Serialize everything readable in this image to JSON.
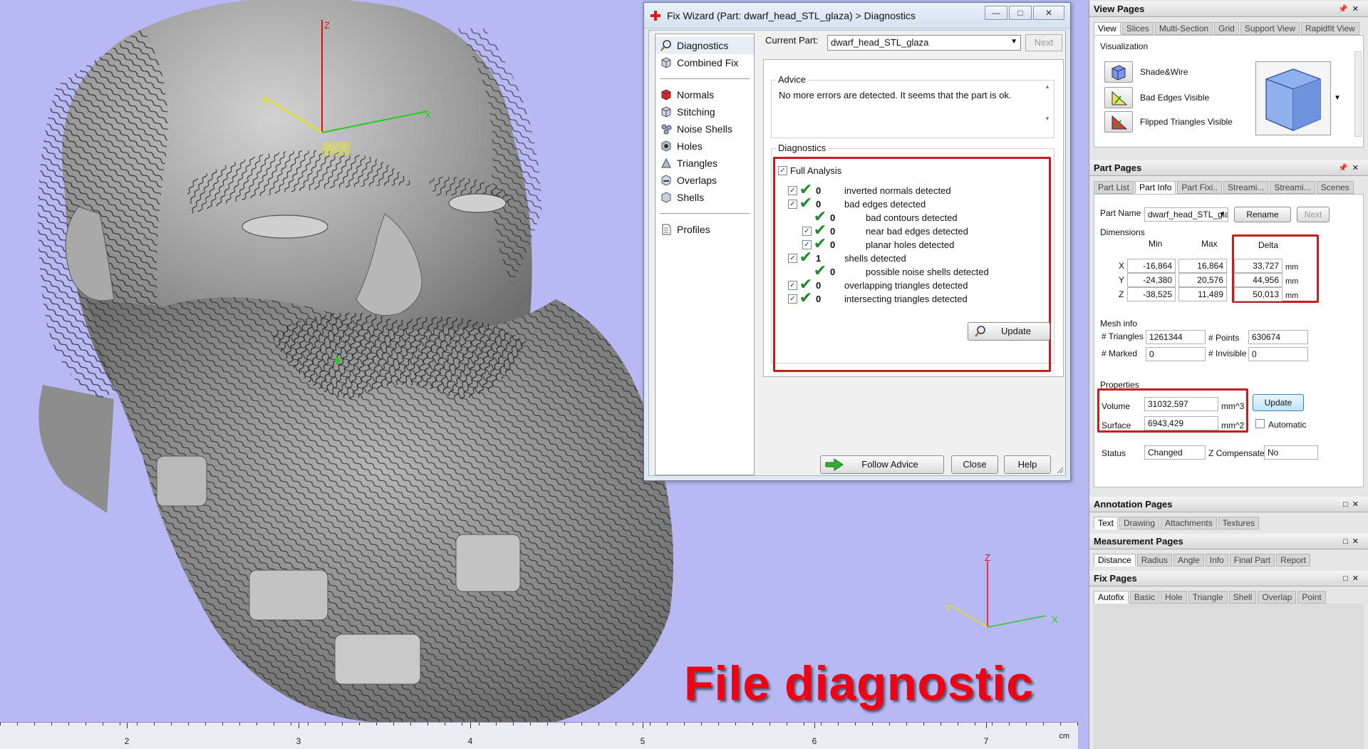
{
  "viewport": {
    "wcs_label": "WCS",
    "axis_labels": {
      "z": "Z",
      "y": "Y",
      "x": "X"
    },
    "ruler": {
      "labels": [
        "2",
        "3",
        "4",
        "5",
        "6",
        "7"
      ],
      "unit": "cm"
    },
    "caption": "File diagnostic",
    "colors": {
      "background": "#b8b8f4",
      "caption": "#f00010"
    }
  },
  "dialog": {
    "title": "Fix Wizard (Part: dwarf_head_STL_glaza) > Diagnostics",
    "nav": {
      "top": [
        {
          "label": "Diagnostics",
          "icon": "magnifier-icon"
        },
        {
          "label": "Combined Fix",
          "icon": "cube-icon"
        }
      ],
      "tools": [
        {
          "label": "Normals",
          "icon": "red-cube-icon"
        },
        {
          "label": "Stitching",
          "icon": "cube-icon"
        },
        {
          "label": "Noise Shells",
          "icon": "noise-icon"
        },
        {
          "label": "Holes",
          "icon": "holes-icon"
        },
        {
          "label": "Triangles",
          "icon": "triangle-icon"
        },
        {
          "label": "Overlaps",
          "icon": "overlap-icon"
        },
        {
          "label": "Shells",
          "icon": "shells-icon"
        }
      ],
      "bottom": [
        {
          "label": "Profiles",
          "icon": "document-icon"
        }
      ]
    },
    "current_part_label": "Current Part:",
    "current_part_value": "dwarf_head_STL_glaza",
    "next_label": "Next",
    "advice_title": "Advice",
    "advice_text": "No more errors are detected. It seems that the part is ok.",
    "diagnostics_title": "Diagnostics",
    "full_analysis_label": "Full Analysis",
    "rows": [
      {
        "count": "0",
        "label": "inverted normals detected"
      },
      {
        "count": "0",
        "label": "bad edges detected"
      },
      {
        "count": "0",
        "label": "bad contours detected"
      },
      {
        "count": "0",
        "label": "near bad edges detected"
      },
      {
        "count": "0",
        "label": "planar holes detected"
      },
      {
        "count": "1",
        "label": "shells detected"
      },
      {
        "count": "0",
        "label": "possible noise shells detected"
      },
      {
        "count": "0",
        "label": "overlapping triangles detected"
      },
      {
        "count": "0",
        "label": "intersecting triangles detected"
      }
    ],
    "update_label": "Update",
    "follow_advice_label": "Follow Advice",
    "close_label": "Close",
    "help_label": "Help"
  },
  "view_pages": {
    "title": "View Pages",
    "tabs": [
      "View",
      "Slices",
      "Multi-Section",
      "Grid",
      "Support View",
      "Rapidfit View"
    ],
    "group_title": "Visualization",
    "options": [
      "Shade&Wire",
      "Bad Edges Visible",
      "Flipped Triangles Visible"
    ]
  },
  "part_pages": {
    "title": "Part Pages",
    "tabs": [
      "Part List",
      "Part Info",
      "Part Fixi..",
      "Streami...",
      "Streami...",
      "Scenes"
    ],
    "part_name_label": "Part Name",
    "part_name_value": "dwarf_head_STL_gla",
    "rename_label": "Rename",
    "next_label": "Next",
    "dimensions_title": "Dimensions",
    "col_headers": [
      "Min",
      "Max",
      "Delta"
    ],
    "dims": [
      {
        "axis": "X",
        "min": "-16,864",
        "max": "16,864",
        "delta": "33,727",
        "unit": "mm"
      },
      {
        "axis": "Y",
        "min": "-24,380",
        "max": "20,576",
        "delta": "44,956",
        "unit": "mm"
      },
      {
        "axis": "Z",
        "min": "-38,525",
        "max": "11,489",
        "delta": "50,013",
        "unit": "mm"
      }
    ],
    "mesh_info_title": "Mesh info",
    "triangles_label": "# Triangles",
    "triangles_value": "1261344",
    "points_label": "# Points",
    "points_value": "630674",
    "marked_label": "# Marked",
    "marked_value": "0",
    "invisible_label": "# Invisible",
    "invisible_value": "0",
    "properties_title": "Properties",
    "volume_label": "Volume",
    "volume_value": "31032,597",
    "volume_unit": "mm^3",
    "surface_label": "Surface",
    "surface_value": "6943,429",
    "surface_unit": "mm^2",
    "update_label": "Update",
    "automatic_label": "Automatic",
    "status_label": "Status",
    "status_value": "Changed",
    "zcomp_label": "Z Compensated",
    "zcomp_value": "No"
  },
  "annotation_pages": {
    "title": "Annotation Pages",
    "tabs": [
      "Text",
      "Drawing",
      "Attachments",
      "Textures"
    ]
  },
  "measurement_pages": {
    "title": "Measurement Pages",
    "tabs": [
      "Distance",
      "Radius",
      "Angle",
      "Info",
      "Final Part",
      "Report"
    ]
  },
  "fix_pages": {
    "title": "Fix Pages",
    "tabs": [
      "Autofix",
      "Basic",
      "Hole",
      "Triangle",
      "Shell",
      "Overlap",
      "Point"
    ]
  }
}
